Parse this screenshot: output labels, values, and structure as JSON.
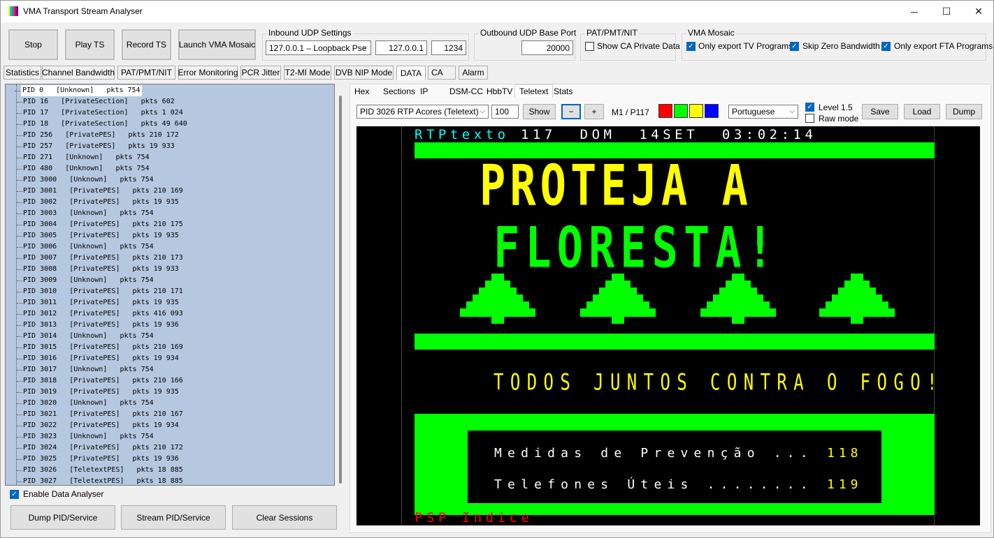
{
  "window": {
    "title": "VMA Transport Stream Analyser",
    "minimize_glyph": "─",
    "maximize_glyph": "☐",
    "close_glyph": "✕"
  },
  "toolbar": {
    "stop": "Stop",
    "play_ts": "Play TS",
    "record_ts": "Record TS",
    "launch_mosaic": "Launch VMA Mosaic"
  },
  "inbound": {
    "title": "Inbound UDP Settings",
    "interface": "127.0.0.1  –  Loopback Pse",
    "address": "127.0.0.1",
    "port": "1234"
  },
  "outbound": {
    "title": "Outbound UDP Base Port",
    "port": "20000"
  },
  "patpmt": {
    "title": "PAT/PMT/NIT",
    "show_ca": "Show CA Private Data"
  },
  "mosaic": {
    "title": "VMA Mosaic",
    "only_tv": "Only export TV Programs",
    "skip_zero": "Skip Zero Bandwidth",
    "only_fta": "Only export FTA Programs"
  },
  "tabs": [
    "Statistics",
    "Channel Bandwidth",
    "PAT/PMT/NIT",
    "Error Monitoring",
    "PCR Jitter",
    "T2-MI Mode",
    "DVB NIP Mode",
    "DATA",
    "CA",
    "Alarm"
  ],
  "pid_list": [
    "PID 0   [Unknown]   pkts 754",
    "PID 16   [PrivateSection]   pkts 602",
    "PID 17   [PrivateSection]   pkts 1 024",
    "PID 18   [PrivateSection]   pkts 49 640",
    "PID 256   [PrivatePES]   pkts 210 172",
    "PID 257   [PrivatePES]   pkts 19 933",
    "PID 271   [Unknown]   pkts 754",
    "PID 480   [Unknown]   pkts 754",
    "PID 3000   [Unknown]   pkts 754",
    "PID 3001   [PrivatePES]   pkts 210 169",
    "PID 3002   [PrivatePES]   pkts 19 935",
    "PID 3003   [Unknown]   pkts 754",
    "PID 3004   [PrivatePES]   pkts 210 175",
    "PID 3005   [PrivatePES]   pkts 19 935",
    "PID 3006   [Unknown]   pkts 754",
    "PID 3007   [PrivatePES]   pkts 210 173",
    "PID 3008   [PrivatePES]   pkts 19 933",
    "PID 3009   [Unknown]   pkts 754",
    "PID 3010   [PrivatePES]   pkts 210 171",
    "PID 3011   [PrivatePES]   pkts 19 935",
    "PID 3012   [PrivatePES]   pkts 416 093",
    "PID 3013   [PrivatePES]   pkts 19 936",
    "PID 3014   [Unknown]   pkts 754",
    "PID 3015   [PrivatePES]   pkts 210 169",
    "PID 3016   [PrivatePES]   pkts 19 934",
    "PID 3017   [Unknown]   pkts 754",
    "PID 3018   [PrivatePES]   pkts 210 166",
    "PID 3019   [PrivatePES]   pkts 19 935",
    "PID 3020   [Unknown]   pkts 754",
    "PID 3021   [PrivatePES]   pkts 210 167",
    "PID 3022   [PrivatePES]   pkts 19 934",
    "PID 3023   [Unknown]   pkts 754",
    "PID 3024   [PrivatePES]   pkts 210 172",
    "PID 3025   [PrivatePES]   pkts 19 936",
    "PID 3026   [TeletextPES]   pkts 18 885",
    "PID 3027   [TeletextPES]   pkts 18 885"
  ],
  "left_bottom": {
    "enable": "Enable Data Analyser",
    "dump": "Dump PID/Service",
    "stream": "Stream PID/Service",
    "clear": "Clear Sessions"
  },
  "subtabs": [
    "Hex",
    "Sections",
    "IP",
    "DSM-CC",
    "HbbTV",
    "Teletext",
    "Stats"
  ],
  "teletext_controls": {
    "pid_select": "PID 3026  RTP Acores (Teletext)",
    "page": "100",
    "show": "Show",
    "minus": "−",
    "plus": "+",
    "mag_page": "M1 / P117",
    "language": "Portuguese",
    "level15": "Level 1.5",
    "raw": "Raw mode",
    "save": "Save",
    "load": "Load",
    "dump": "Dump",
    "swatches": [
      "#ff0000",
      "#00ff00",
      "#ffff00",
      "#0000ff"
    ]
  },
  "teletext_page": {
    "header_service": "RTPtexto",
    "header_info": " 117  DOM  14SET  03:02:14",
    "line1": "PROTEJA A",
    "line2": "FLORESTA!",
    "slogan": "TODOS JUNTOS CONTRA O FOGO!",
    "menu1_text": "Medidas de Prevenção ...",
    "menu1_page": "118",
    "menu2_text": "Telefones Úteis ........",
    "menu2_page": "119",
    "footer": "PSP Indice",
    "colors": {
      "cyan": "#00ffff",
      "green": "#00ff00",
      "yellow": "#ffff00",
      "red": "#ff0000",
      "white": "#ffffff"
    }
  }
}
